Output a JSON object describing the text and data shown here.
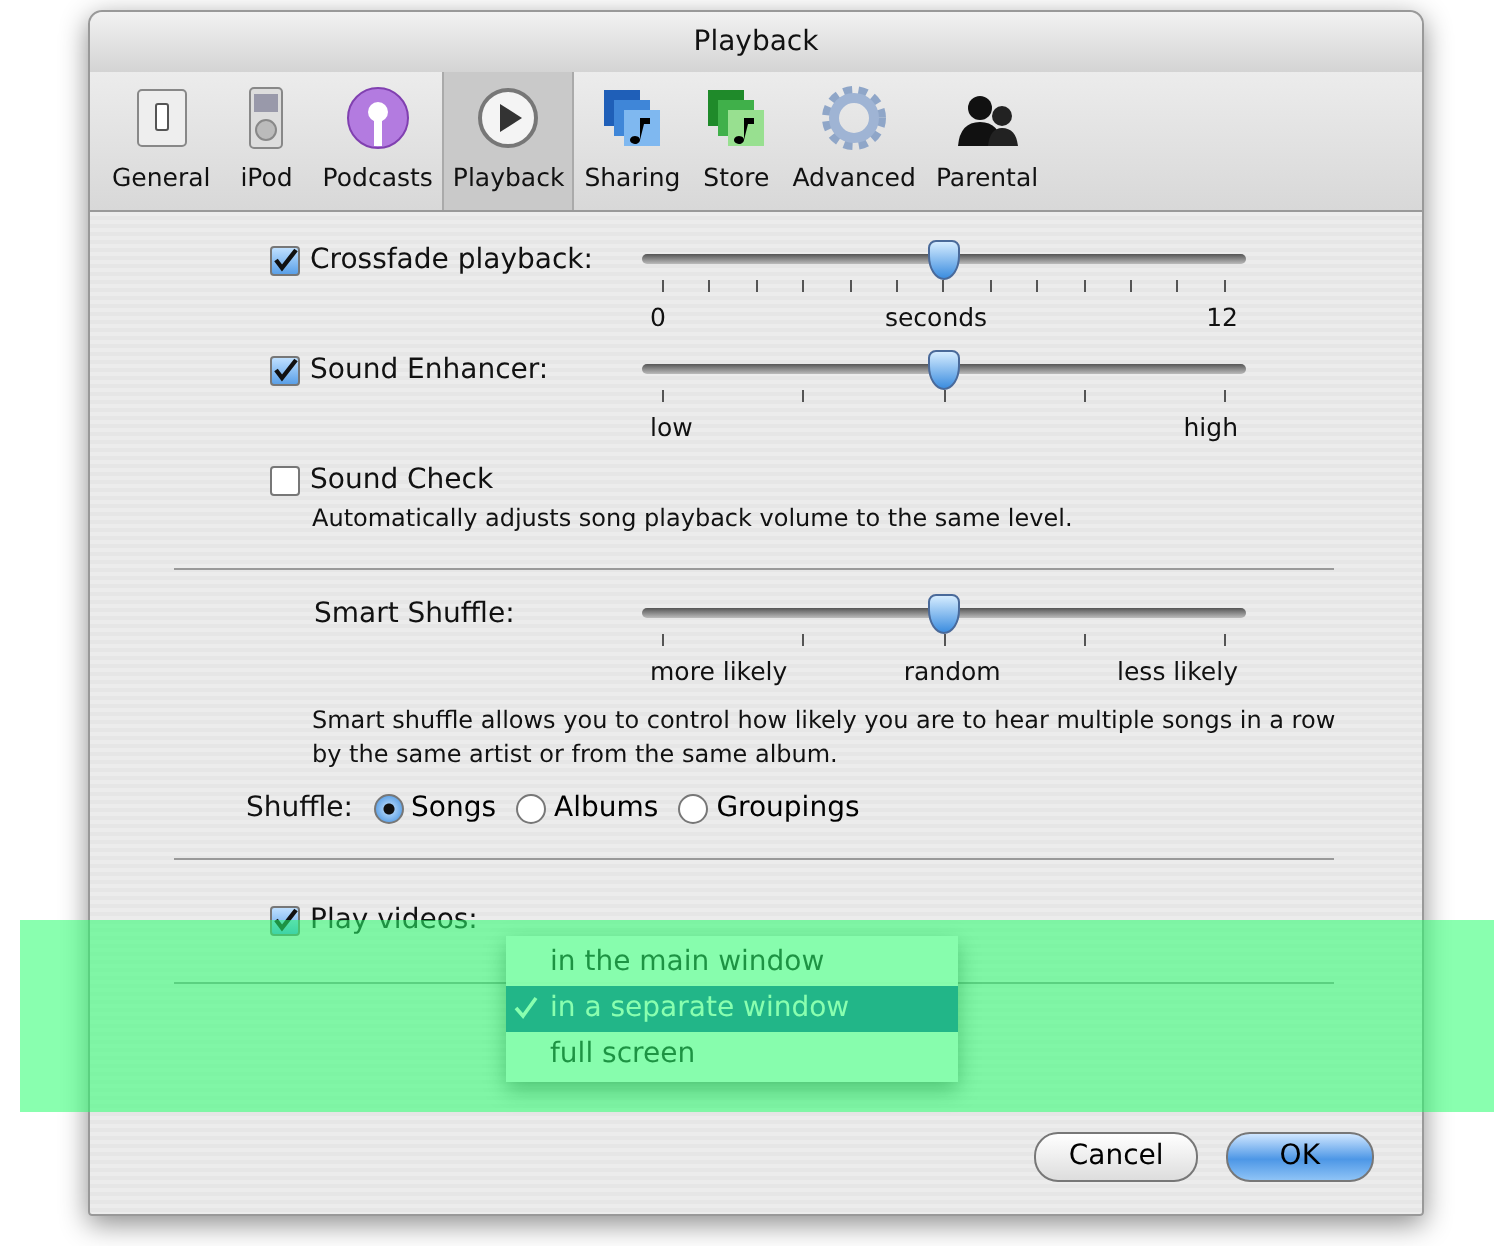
{
  "window": {
    "title": "Playback"
  },
  "tabs": [
    {
      "label": "General",
      "selected": false
    },
    {
      "label": "iPod",
      "selected": false
    },
    {
      "label": "Podcasts",
      "selected": false
    },
    {
      "label": "Playback",
      "selected": true
    },
    {
      "label": "Sharing",
      "selected": false
    },
    {
      "label": "Store",
      "selected": false
    },
    {
      "label": "Advanced",
      "selected": false
    },
    {
      "label": "Parental",
      "selected": false
    }
  ],
  "options": [
    {
      "kind": "check_slider",
      "label": "Crossfade playback:",
      "checked": true,
      "level": 0.5,
      "scale_labels": [
        "0",
        "seconds",
        "12"
      ]
    },
    {
      "kind": "check_slider",
      "label": "Sound Enhancer:",
      "checked": true,
      "level": 0.5,
      "scale_labels": [
        "low",
        "high"
      ]
    },
    {
      "kind": "checkbox",
      "label": "Sound Check",
      "checked": false,
      "description": "Automatically adjusts song playback volume to the same level."
    }
  ],
  "smart_shuffle": {
    "label": "Smart Shuffle:",
    "level": 0.5,
    "scale_labels": [
      "more likely",
      "random",
      "less likely"
    ],
    "description": "Smart shuffle allows you to control how likely you are to hear multiple songs in a row by the same artist or from the same album."
  },
  "shuffle": {
    "label": "Shuffle:",
    "options": [
      {
        "label": "Songs",
        "selected": true
      },
      {
        "label": "Albums",
        "selected": false
      },
      {
        "label": "Groupings",
        "selected": false
      }
    ]
  },
  "play_videos": {
    "label": "Play videos:",
    "checked": true,
    "menu": [
      {
        "label": "in the main window",
        "selected": false
      },
      {
        "label": "in a separate window",
        "selected": true
      },
      {
        "label": "full screen",
        "selected": false
      }
    ]
  },
  "buttons": [
    {
      "label": "Cancel",
      "kind": "normal"
    },
    {
      "label": "OK",
      "kind": "default"
    }
  ]
}
